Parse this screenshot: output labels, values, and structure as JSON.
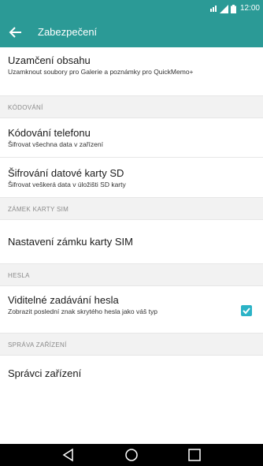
{
  "status_bar": {
    "time": "12:00",
    "signal_icon": "signal-icon",
    "battery_icon": "battery-icon",
    "network_icon": "network-type-icon"
  },
  "app_bar": {
    "title": "Zabezpečení",
    "back_icon": "arrow-back-icon"
  },
  "items": [
    {
      "title": "Uzamčení obsahu",
      "subtitle": "Uzamknout soubory pro Galerie a poznámky pro QuickMemo+"
    },
    {
      "section": "KÓDOVÁNÍ"
    },
    {
      "title": "Kódování telefonu",
      "subtitle": "Šifrovat všechna data v zařízení"
    },
    {
      "title": "Šifrování datové karty SD",
      "subtitle": "Šifrovat veškerá data v úložišti SD karty"
    },
    {
      "section": "ZÁMEK KARTY SIM"
    },
    {
      "title": "Nastavení zámku karty SIM"
    },
    {
      "section": "HESLA"
    },
    {
      "title": "Viditelné zadávání hesla",
      "subtitle": "Zobrazit poslední znak skrytého hesla jako váš typ",
      "checked": true
    },
    {
      "section": "SPRÁVA ZAŘÍZENÍ"
    },
    {
      "title": "Správci zařízení"
    }
  ],
  "nav_bar": {
    "back_icon": "triangle-back-icon",
    "home_icon": "circle-home-icon",
    "recents_icon": "square-recents-icon"
  },
  "colors": {
    "accent": "#2b9a96",
    "checkbox": "#2bb3c6",
    "section_bg": "#f2f2f2"
  }
}
